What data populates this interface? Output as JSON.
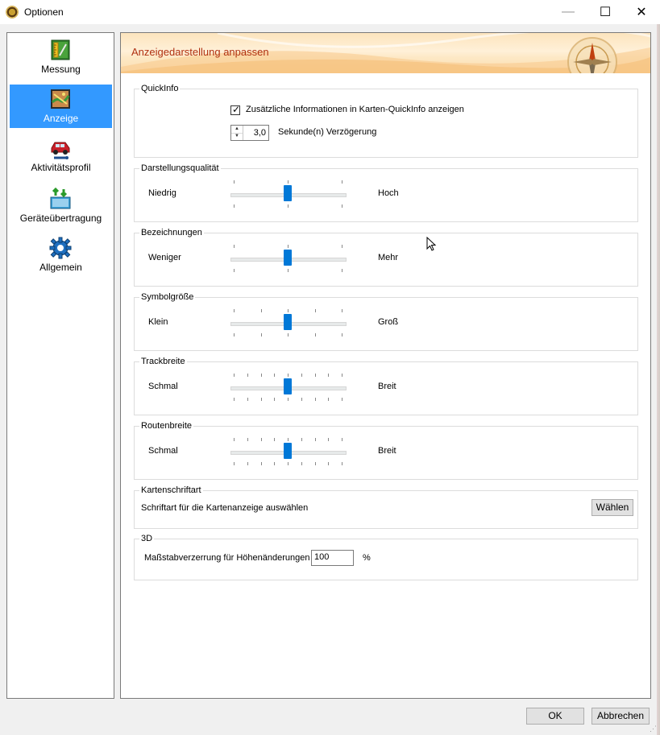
{
  "window": {
    "title": "Optionen",
    "controls": {
      "minimize": "—",
      "maximize": "☐",
      "close": "✕"
    }
  },
  "sidebar": {
    "items": [
      {
        "label": "Messung",
        "icon": "ruler-icon",
        "active": false
      },
      {
        "label": "Anzeige",
        "icon": "map-display-icon",
        "active": true
      },
      {
        "label": "Aktivitätsprofil",
        "icon": "car-wrench-icon",
        "active": false
      },
      {
        "label": "Geräteübertragung",
        "icon": "device-transfer-icon",
        "active": false
      },
      {
        "label": "Allgemein",
        "icon": "gear-icon",
        "active": false
      }
    ]
  },
  "header": {
    "title": "Anzeigedarstellung anpassen"
  },
  "quickinfo": {
    "title": "QuickInfo",
    "checkbox_label": "Zusätzliche Informationen in Karten-QuickInfo anzeigen",
    "checked": true,
    "delay_value": "3,0",
    "delay_label": "Sekunde(n) Verzögerung"
  },
  "sliders": [
    {
      "title": "Darstellungsqualität",
      "min_label": "Niedrig",
      "max_label": "Hoch",
      "level": 0.5
    },
    {
      "title": "Bezeichnungen",
      "min_label": "Weniger",
      "max_label": "Mehr",
      "level": 0.5
    },
    {
      "title": "Symbolgröße",
      "min_label": "Klein",
      "max_label": "Groß",
      "level": 0.5
    },
    {
      "title": "Trackbreite",
      "min_label": "Schmal",
      "max_label": "Breit",
      "level": 0.5
    },
    {
      "title": "Routenbreite",
      "min_label": "Schmal",
      "max_label": "Breit",
      "level": 0.5
    }
  ],
  "font_group": {
    "title": "Kartenschriftart",
    "label": "Schriftart für die Kartenanzeige auswählen",
    "button": "Wählen"
  },
  "three_d": {
    "title": "3D",
    "label": "Maßstabverzerrung für Höhenänderungen",
    "value": "100",
    "unit": "%"
  },
  "footer": {
    "ok": "OK",
    "cancel": "Abbrechen"
  },
  "colors": {
    "accent": "#0078d7",
    "selection": "#3399ff",
    "header_text": "#b03010"
  }
}
